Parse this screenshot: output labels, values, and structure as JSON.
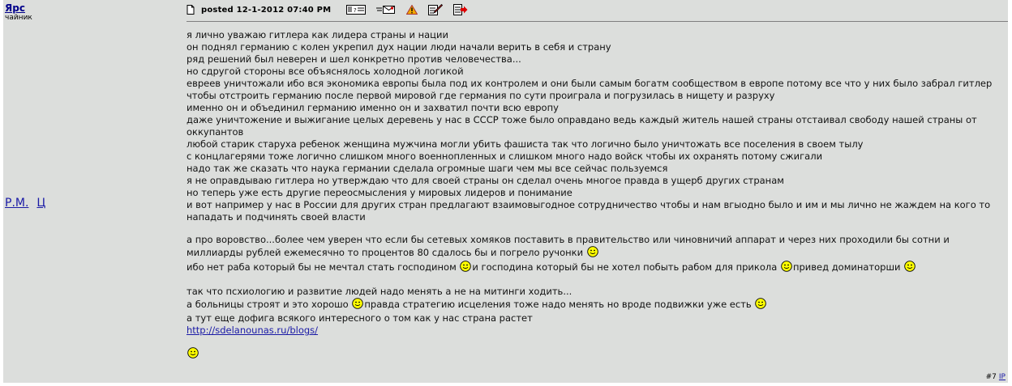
{
  "author": {
    "name": "Ярс",
    "rank": "чайник",
    "pm_link": "Р.М.",
    "q_link": "Ц"
  },
  "header": {
    "posted": "posted 12-1-2012 07:40 PM",
    "icons": [
      "page-icon",
      "profile-icon",
      "email-icon",
      "warning-icon",
      "edit-icon",
      "quote-icon"
    ]
  },
  "body": {
    "paragraph1": [
      "я лично уважаю гитлера как лидера страны и нации",
      "он поднял германию с колен укрепил дух нации люди начали верить в себя и страну",
      "ряд решений был неверен и шел конкретно против человечества...",
      "но сдругой стороны все объяснялось холодной логикой",
      "евреев уничтожали ибо вся экономика европы была под их контролем и они были самым богатм сообществом в европе потому все что у них было забрал гитлер",
      "чтобы отстроить германию после первой мировой где германия по сути проиграла и погрузилась в нищету и разруху",
      "именно он и объединил германию именно он и захватил почти всю европу",
      "даже уничтожение и выжигание целых деревень у нас в СССР тоже было оправдано ведь каждый житель нашей страны отстаивал свободу нашей страны от оккупантов",
      "любой старик старуха ребенок женщина мужчина могли убить фашиста так что логично было уничтожать все поселения в своем тылу",
      "с концлагерями тоже логично слишком много военнопленных и слишком много надо войск чтобы их охранять потому сжигали",
      "надо так же сказать что наука германии сделала огромные шаги чем мы все сейчас пользуемся",
      "я не оправдываю гитлера но утверждаю что для своей страны он сделал очень многое правда в ущерб других странам",
      "но теперь уже есть другие переосмысления у мировых лидеров и понимание",
      "и вот например у нас в России для других стран предлагают взаимовыгодное сотрудничество чтобы и нам вгыодно было и им и мы лично не жаждем на кого то нападать и подчинять своей власти"
    ],
    "p2_line1": "а про воровство...более чем уверен что если бы сетевых хомяков поставить в правительство или чиновничий аппарат и через них проходили бы сотни и миллиарды рублей ежемесячно то процентов 80 сдалось бы и погрело ручонки",
    "p2_line2a": "ибо нет раба который бы не мечтал стать господином",
    "p2_line2b": "и господина который бы не хотел побыть рабом для прикола",
    "p2_line2c": "привед доминаторши",
    "p3_line1": "так что псхиологию и развитие людей надо менять а не на митинги ходить...",
    "p3_line2a": "а больницы строят и это хорошо",
    "p3_line2b": "правда стратегию исцеления тоже надо менять но вроде подвижки уже есть",
    "p3_line3": "а тут еще дофига всякого интересного о том как у нас страна растет",
    "link": "http://sdelanounas.ru/blogs/"
  },
  "footer": {
    "post_number": "#7",
    "ip_label": "IP"
  },
  "colors": {
    "post_bg": "#dcdedc",
    "link": "#1a1aa6",
    "author": "#00008b",
    "smiley": "#ffff00"
  }
}
